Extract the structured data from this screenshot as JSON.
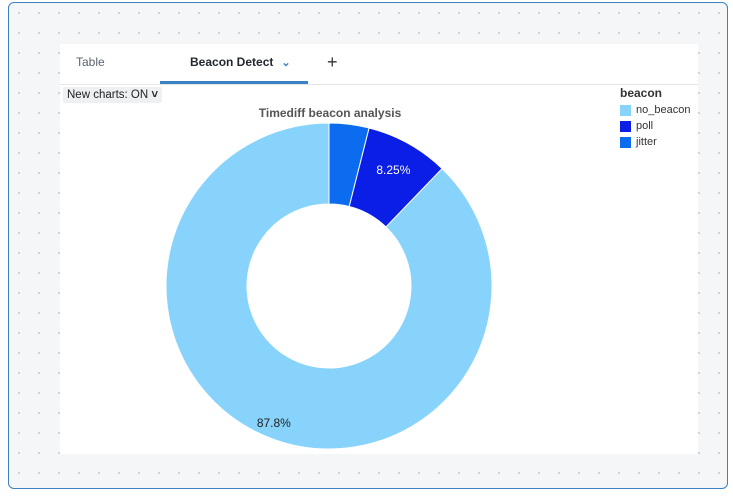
{
  "tabs": [
    {
      "label": "Table",
      "active": false
    },
    {
      "label": "Beacon Detect",
      "active": true
    },
    {
      "label": "+",
      "active": false
    }
  ],
  "tab_dropdown_icon": "chevron-down-icon",
  "new_charts_label": "New charts: ON",
  "colors": {
    "accent": "#3b82c4"
  },
  "chart_data": {
    "type": "pie",
    "title": "Timediff beacon analysis",
    "legend_title": "beacon",
    "legend_position": "top-right",
    "donut": true,
    "categories": [
      "no_beacon",
      "poll",
      "jitter"
    ],
    "values": [
      87.8,
      8.25,
      3.95
    ],
    "colors": [
      "#87d3fc",
      "#0b1ee6",
      "#0b6cf0"
    ],
    "labels": [
      "87.8%",
      "8.25%",
      ""
    ]
  }
}
